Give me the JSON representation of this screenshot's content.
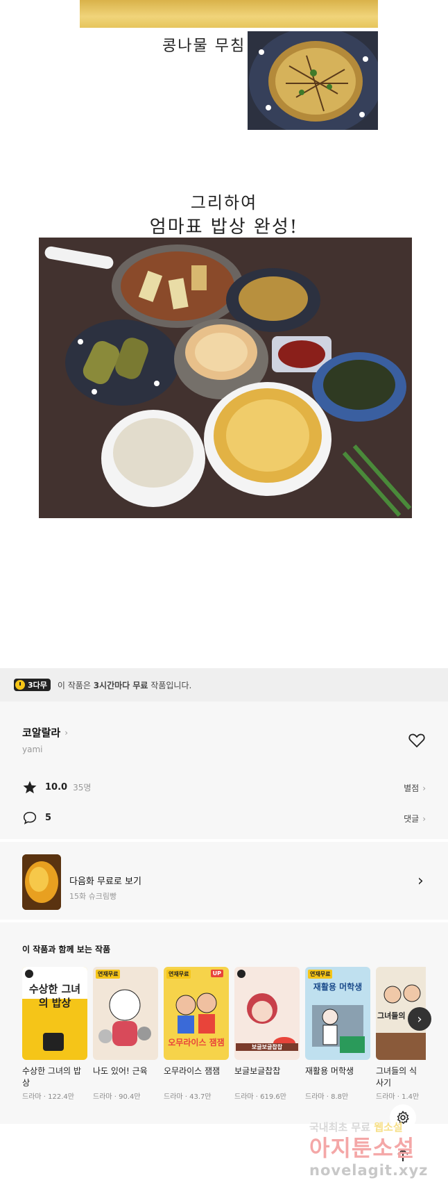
{
  "comic": {
    "caption_top": "콩나물 무침",
    "caption_main_1": "그리하여",
    "caption_main_2": "엄마표 밥상 완성!"
  },
  "free_bar": {
    "badge": "3다무",
    "text_pre": "이 작품은 ",
    "text_bold": "3시간마다 무료",
    "text_post": " 작품입니다."
  },
  "info": {
    "title": "코알랄라",
    "author": "yami",
    "rating": "10.0",
    "rating_count": "35명",
    "rating_link": "별점",
    "comments": "5",
    "comments_link": "댓글"
  },
  "next_episode": {
    "title": "다음화 무료로 보기",
    "subtitle": "15화 슈크림빵"
  },
  "recommendations": {
    "heading": "이 작품과 함께 보는 작품",
    "items": [
      {
        "title": "수상한 그녀의 밥상",
        "meta": "드라마 · 122.4만",
        "cover": "수상한 그녀의 밥상",
        "tag": "",
        "bg": "#f5c518"
      },
      {
        "title": "나도 있어! 근육",
        "meta": "드라마 · 90.4만",
        "cover": "",
        "tag": "연재무료",
        "bg": "#f2e6d8"
      },
      {
        "title": "오무라이스 잼잼",
        "meta": "드라마 · 43.7만",
        "cover": "오무라이스 잼잼",
        "tag": "연재무료",
        "bg": "#f6d34a"
      },
      {
        "title": "보글보글찹찹",
        "meta": "드라마 · 619.6만",
        "cover": "보글보글찹찹",
        "tag": "",
        "bg": "#f4d6d0"
      },
      {
        "title": "재활용 머학생",
        "meta": "드라마 · 8.8만",
        "cover": "재활용 머학생",
        "tag": "연재무료",
        "bg": "#bfe0ef"
      },
      {
        "title": "그녀들의 식사기",
        "meta": "드라마 · 1.4만",
        "cover": "그녀들의",
        "tag": "",
        "bg": "#efe7d8"
      }
    ]
  },
  "watermark": {
    "line1a": "국내최초 무료 ",
    "line1b": "웹소설",
    "line2": "아지툰소설",
    "line3": "novelagit.xyz"
  },
  "icons": {
    "settings": "gear-icon",
    "scroll_top": "arrow-up-icon",
    "like": "heart-icon",
    "carousel_next": "chevron-right-icon"
  }
}
